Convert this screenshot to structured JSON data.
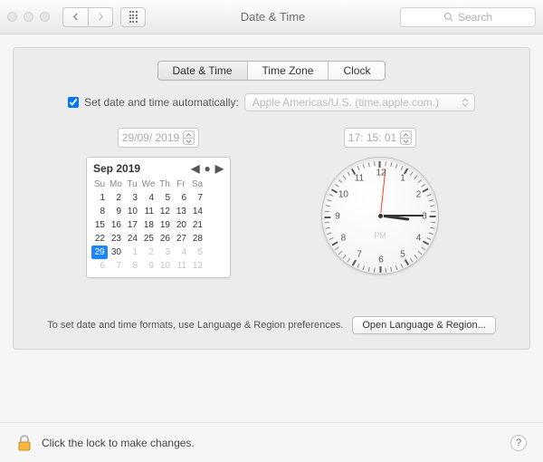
{
  "window": {
    "title": "Date & Time",
    "search_placeholder": "Search"
  },
  "tabs": {
    "date_time": "Date & Time",
    "time_zone": "Time Zone",
    "clock": "Clock",
    "active": "date_time"
  },
  "auto": {
    "label": "Set date and time automatically:",
    "checked": true,
    "server": "Apple Americas/U.S. (time.apple.com.)"
  },
  "date": {
    "field": "29/09/ 2019",
    "month_label": "Sep 2019",
    "dow": [
      "Su",
      "Mo",
      "Tu",
      "We",
      "Th",
      "Fr",
      "Sa"
    ],
    "days": [
      {
        "n": 1
      },
      {
        "n": 2
      },
      {
        "n": 3
      },
      {
        "n": 4
      },
      {
        "n": 5
      },
      {
        "n": 6
      },
      {
        "n": 7
      },
      {
        "n": 8
      },
      {
        "n": 9
      },
      {
        "n": 10
      },
      {
        "n": 11
      },
      {
        "n": 12
      },
      {
        "n": 13
      },
      {
        "n": 14
      },
      {
        "n": 15
      },
      {
        "n": 16
      },
      {
        "n": 17
      },
      {
        "n": 18
      },
      {
        "n": 19
      },
      {
        "n": 20
      },
      {
        "n": 21
      },
      {
        "n": 22
      },
      {
        "n": 23
      },
      {
        "n": 24
      },
      {
        "n": 25
      },
      {
        "n": 26
      },
      {
        "n": 27
      },
      {
        "n": 28
      },
      {
        "n": 29,
        "sel": true
      },
      {
        "n": 30
      },
      {
        "n": 1,
        "muted": true
      },
      {
        "n": 2,
        "muted": true
      },
      {
        "n": 3,
        "muted": true
      },
      {
        "n": 4,
        "muted": true
      },
      {
        "n": 5,
        "muted": true
      },
      {
        "n": 6,
        "muted": true
      },
      {
        "n": 7,
        "muted": true
      },
      {
        "n": 8,
        "muted": true
      },
      {
        "n": 9,
        "muted": true
      },
      {
        "n": 10,
        "muted": true
      },
      {
        "n": 11,
        "muted": true
      },
      {
        "n": 12,
        "muted": true
      }
    ]
  },
  "time": {
    "field": "17: 15: 01",
    "ampm": "PM",
    "hour_angle": 97.5,
    "minute_angle": 90,
    "second_angle": 6
  },
  "hint": {
    "text": "To set date and time formats, use Language & Region preferences.",
    "button": "Open Language & Region..."
  },
  "footer": {
    "lock_text": "Click the lock to make changes."
  }
}
